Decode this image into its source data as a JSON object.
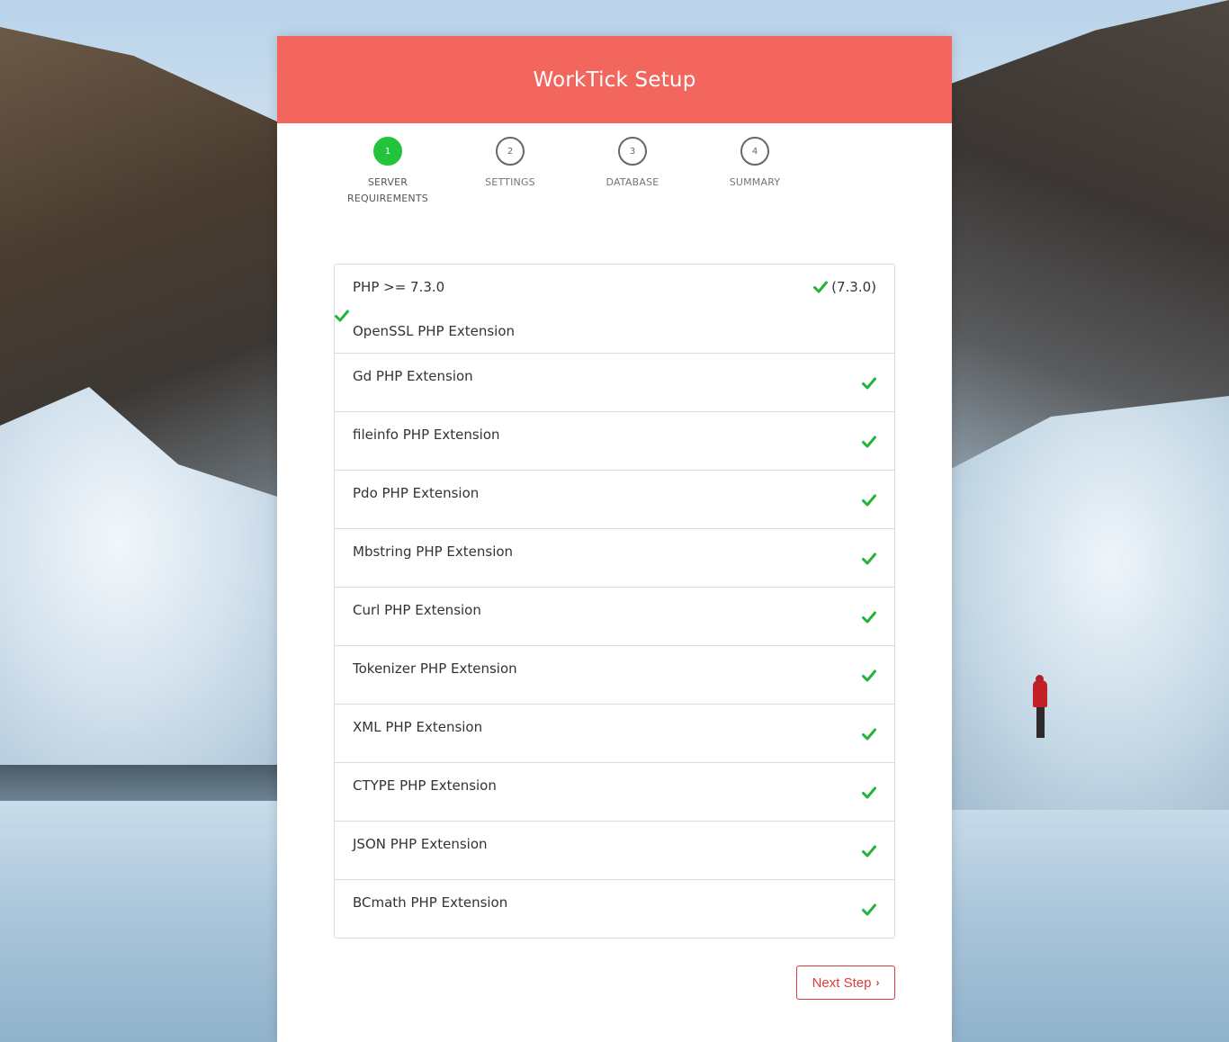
{
  "header": {
    "title": "WorkTick Setup"
  },
  "steps": [
    {
      "number": "1",
      "label_line1": "SERVER",
      "label_line2": "REQUIREMENTS",
      "active": true
    },
    {
      "number": "2",
      "label_line1": "SETTINGS",
      "label_line2": "",
      "active": false
    },
    {
      "number": "3",
      "label_line1": "DATABASE",
      "label_line2": "",
      "active": false
    },
    {
      "number": "4",
      "label_line1": "SUMMARY",
      "label_line2": "",
      "active": false
    }
  ],
  "requirements": {
    "php": {
      "label": "PHP >= 7.3.0",
      "version": "(7.3.0)"
    },
    "extensions": [
      {
        "label": "OpenSSL PHP Extension"
      },
      {
        "label": "Gd PHP Extension"
      },
      {
        "label": "fileinfo PHP Extension"
      },
      {
        "label": "Pdo PHP Extension"
      },
      {
        "label": "Mbstring PHP Extension"
      },
      {
        "label": "Curl PHP Extension"
      },
      {
        "label": "Tokenizer PHP Extension"
      },
      {
        "label": "XML PHP Extension"
      },
      {
        "label": "CTYPE PHP Extension"
      },
      {
        "label": "JSON PHP Extension"
      },
      {
        "label": "BCmath PHP Extension"
      }
    ],
    "check_icon": "check-icon",
    "check_color": "#23b33a"
  },
  "actions": {
    "next_label": "Next Step",
    "next_icon": "chevron-right-icon"
  },
  "colors": {
    "header": "#f2665d",
    "active_step": "#23c33c",
    "button": "#e03b3b"
  }
}
